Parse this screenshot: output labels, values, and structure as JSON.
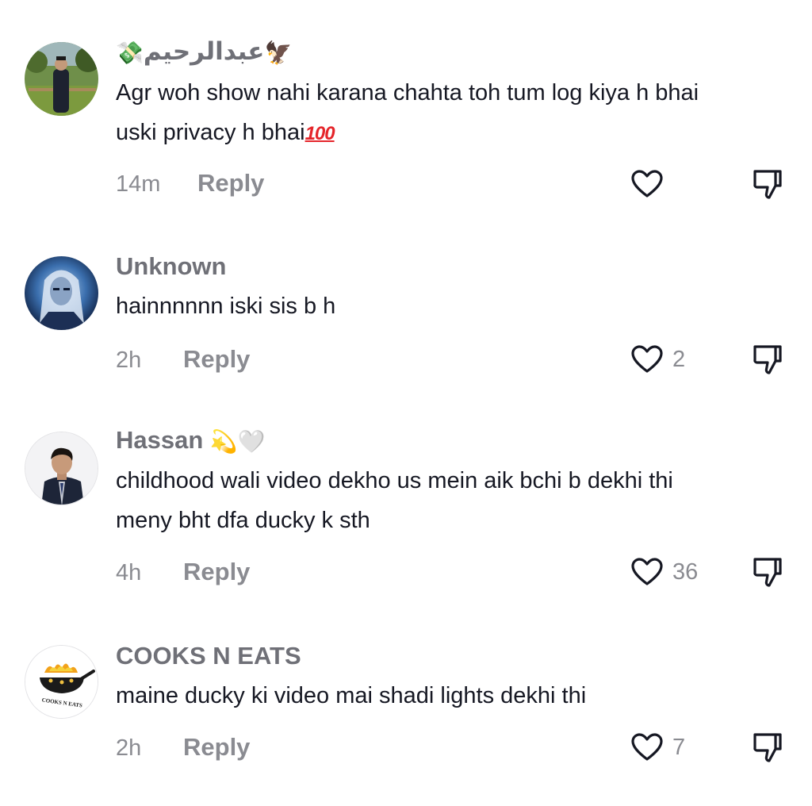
{
  "comments": [
    {
      "username": "عبدالرحيم",
      "username_prefix_emoji": "💸",
      "username_suffix_emoji": "🦅",
      "text_line1": "Agr woh show nahi karana chahta toh tum log kiya h bhai",
      "text_line2": "uski privacy h bhai",
      "text_emoji": "100",
      "time": "14m",
      "reply_label": "Reply",
      "likes": "",
      "avatar_icon": "person-outdoors-avatar"
    },
    {
      "username": "Unknown",
      "text_line1": "hainnnnnn iski sis b h",
      "time": "2h",
      "reply_label": "Reply",
      "likes": "2",
      "avatar_icon": "white-haired-character-avatar"
    },
    {
      "username": "Hassan",
      "username_suffix_emoji": "💫🤍",
      "text_line1": "childhood wali video dekho us mein aik bchi b dekhi thi",
      "text_line2": "meny bht dfa ducky k sth",
      "time": "4h",
      "reply_label": "Reply",
      "likes": "36",
      "avatar_icon": "man-in-suit-avatar"
    },
    {
      "username": "COOKS N EATS",
      "text_line1": "maine ducky ki video mai shadi lights dekhi thi",
      "time": "2h",
      "reply_label": "Reply",
      "likes": "7",
      "avatar_icon": "cooking-wok-logo-avatar",
      "avatar_logo_text": "COOKS N EATS"
    }
  ],
  "colors": {
    "username": "#6f7077",
    "text": "#161823",
    "meta": "#8a8b91",
    "hundred_emoji": "#e5252a"
  },
  "icons": {
    "like": "heart-outline-icon",
    "dislike": "thumbs-down-outline-icon"
  }
}
